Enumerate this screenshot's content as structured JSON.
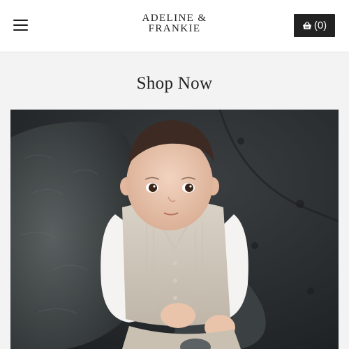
{
  "header": {
    "menu_icon": "hamburger-menu-icon",
    "logo": {
      "line1": "ADELINE &",
      "line2": "FRANKIE"
    },
    "cart": {
      "icon": "basket-icon",
      "count_label": "(0)"
    }
  },
  "main": {
    "title": "Shop Now",
    "hero_image": {
      "description_icon": "hero-photo"
    }
  },
  "colors": {
    "header_bg": "#ffffff",
    "page_bg": "#f3f3f3",
    "button_bg": "#222222",
    "text": "#222222"
  }
}
